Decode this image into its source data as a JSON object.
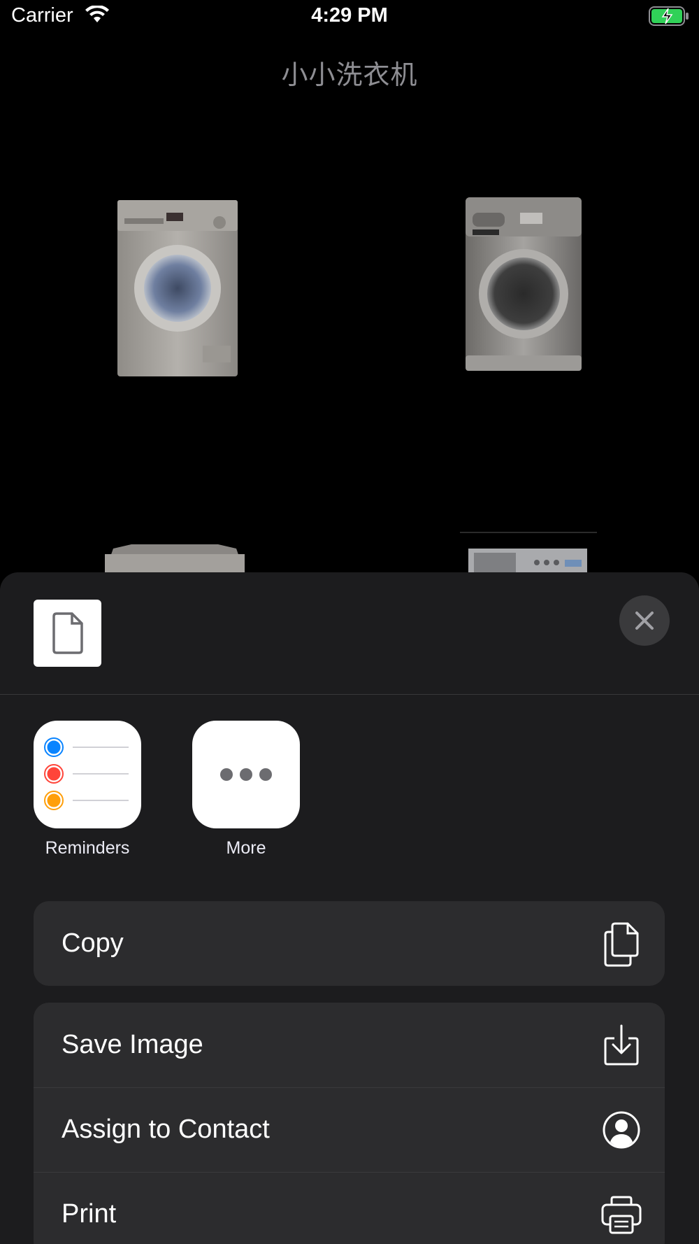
{
  "status_bar": {
    "carrier": "Carrier",
    "time": "4:29 PM",
    "battery_color": "#30d158"
  },
  "app": {
    "title": "小小洗衣机"
  },
  "share_sheet": {
    "close_icon": "close-icon",
    "document_icon": "document-icon",
    "apps": [
      {
        "label": "Reminders",
        "icon": "reminders-icon"
      },
      {
        "label": "More",
        "icon": "more-icon"
      }
    ],
    "actions_group1": [
      {
        "label": "Copy",
        "icon": "copy-icon"
      }
    ],
    "actions_group2": [
      {
        "label": "Save Image",
        "icon": "save-image-icon"
      },
      {
        "label": "Assign to Contact",
        "icon": "contact-icon"
      },
      {
        "label": "Print",
        "icon": "print-icon"
      }
    ]
  },
  "colors": {
    "background": "#000000",
    "sheet": "#1c1c1e",
    "row": "#2c2c2e",
    "reminder_blue": "#0a84ff",
    "reminder_red": "#ff453a",
    "reminder_orange": "#ff9f0a"
  }
}
